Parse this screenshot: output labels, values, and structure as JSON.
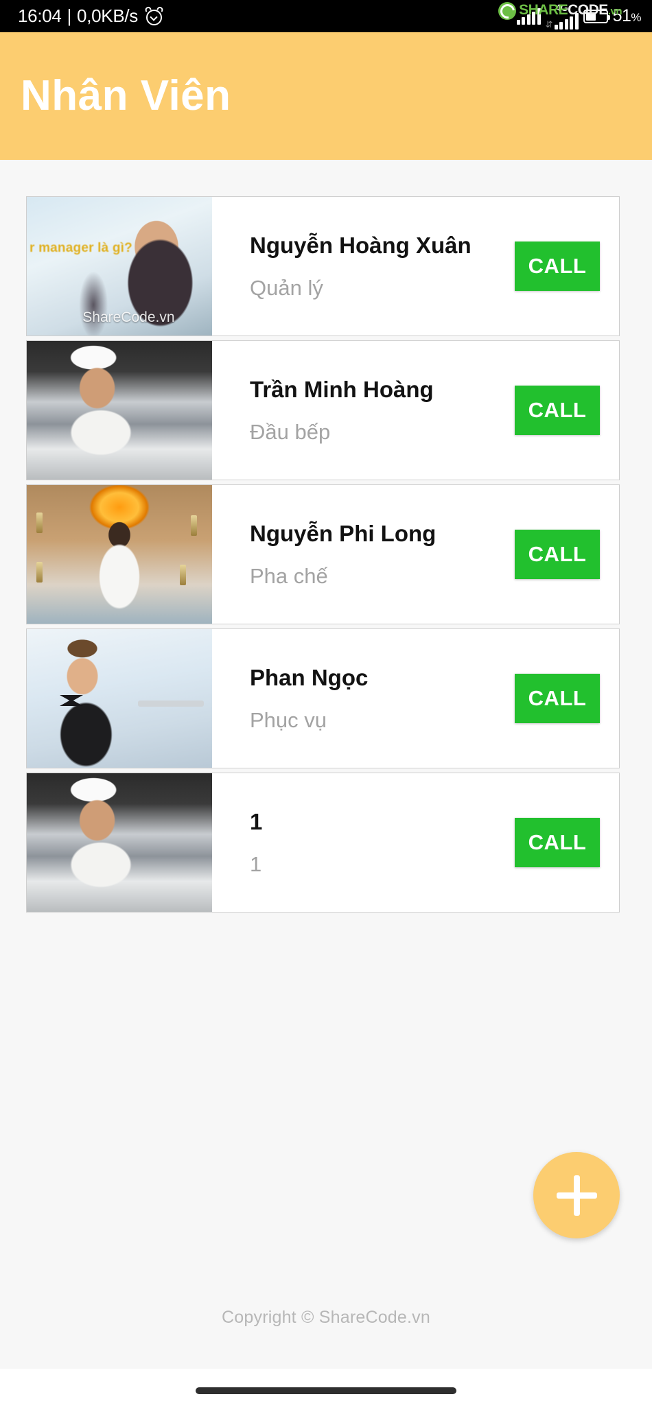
{
  "status_bar": {
    "time": "16:04",
    "separator": "|",
    "network_speed": "0,0KB/s",
    "alarm_icon": "alarm-clock-icon",
    "signal_icon": "signal-bars-icon",
    "network_type": "4G",
    "data_transfer_icon": "up-down-arrows-icon",
    "battery_icon": "battery-icon",
    "battery_percent": "51",
    "percent_sign": "%",
    "watermark": {
      "share": "SHARE",
      "code": "CODE",
      "tld": ".vn",
      "logo_icon": "sharecode-logo-icon"
    }
  },
  "app_bar": {
    "title": "Nhân Viên",
    "background": "#fccd70",
    "title_color": "#ffffff"
  },
  "employees": [
    {
      "name": "Nguyễn Hoàng Xuân",
      "role": "Quản lý",
      "call_label": "CALL",
      "photo": "manager-photo",
      "photo_caption": "r manager là gì?",
      "photo_watermark": "ShareCode.vn"
    },
    {
      "name": "Trần Minh Hoàng",
      "role": "Đầu bếp",
      "call_label": "CALL",
      "photo": "chef-photo",
      "photo_caption": "",
      "photo_watermark": ""
    },
    {
      "name": "Nguyễn Phi Long",
      "role": "Pha chế",
      "call_label": "CALL",
      "photo": "bartender-photo",
      "photo_caption": "",
      "photo_watermark": ""
    },
    {
      "name": "Phan Ngọc",
      "role": "Phục vụ",
      "call_label": "CALL",
      "photo": "waiter-photo",
      "photo_caption": "",
      "photo_watermark": ""
    },
    {
      "name": "1",
      "role": "1",
      "call_label": "CALL",
      "photo": "chef-photo",
      "photo_caption": "",
      "photo_watermark": ""
    }
  ],
  "fab": {
    "icon": "plus-icon",
    "color": "#fccd70"
  },
  "footer": {
    "text": "Copyright © ShareCode.vn"
  },
  "nav_bar": {
    "gesture_handle": "gesture-pill"
  },
  "colors": {
    "accent": "#fccd70",
    "call_green": "#22c02e",
    "page_background": "#f7f7f7",
    "card_background": "#ffffff",
    "name_text": "#121212",
    "role_text": "#a3a3a3"
  }
}
